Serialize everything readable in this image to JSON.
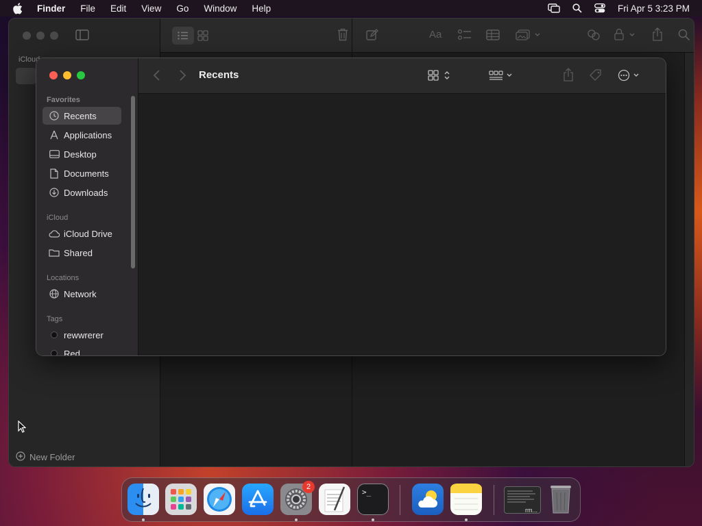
{
  "menubar": {
    "app_name": "Finder",
    "items": [
      "File",
      "Edit",
      "View",
      "Go",
      "Window",
      "Help"
    ],
    "clock": "Fri Apr 5  3:23 PM"
  },
  "notes_window": {
    "sidebar_section": "iCloud",
    "new_folder_label": "New Folder"
  },
  "finder": {
    "title": "Recents",
    "sidebar": {
      "favorites_header": "Favorites",
      "favorites": [
        {
          "label": "Recents",
          "icon": "clock-icon",
          "selected": true
        },
        {
          "label": "Applications",
          "icon": "applications-icon"
        },
        {
          "label": "Desktop",
          "icon": "desktop-icon"
        },
        {
          "label": "Documents",
          "icon": "document-icon"
        },
        {
          "label": "Downloads",
          "icon": "download-icon"
        }
      ],
      "icloud_header": "iCloud",
      "icloud": [
        {
          "label": "iCloud Drive",
          "icon": "cloud-icon"
        },
        {
          "label": "Shared",
          "icon": "shared-folder-icon"
        }
      ],
      "locations_header": "Locations",
      "locations": [
        {
          "label": "Network",
          "icon": "globe-icon"
        }
      ],
      "tags_header": "Tags",
      "tags": [
        {
          "label": "rewwrerer",
          "color": "#111111"
        },
        {
          "label": "Red",
          "color": "#111111"
        }
      ]
    }
  },
  "dock": {
    "apps": [
      {
        "name": "Finder",
        "running": true
      },
      {
        "name": "Launchpad",
        "running": false
      },
      {
        "name": "Safari",
        "running": false
      },
      {
        "name": "App Store",
        "running": false
      },
      {
        "name": "System Settings",
        "running": true,
        "badge": "2"
      },
      {
        "name": "TextEdit",
        "running": false
      },
      {
        "name": "Terminal",
        "running": true
      },
      {
        "name": "Weather",
        "running": false
      },
      {
        "name": "Notes",
        "running": true
      },
      {
        "name": "Terminal Window",
        "running": false,
        "label": "rm..."
      },
      {
        "name": "Trash",
        "running": false
      }
    ]
  },
  "colors": {
    "close": "#fe5f57",
    "minimize": "#febc2e",
    "zoom": "#28c840",
    "badge": "#e8392e"
  }
}
